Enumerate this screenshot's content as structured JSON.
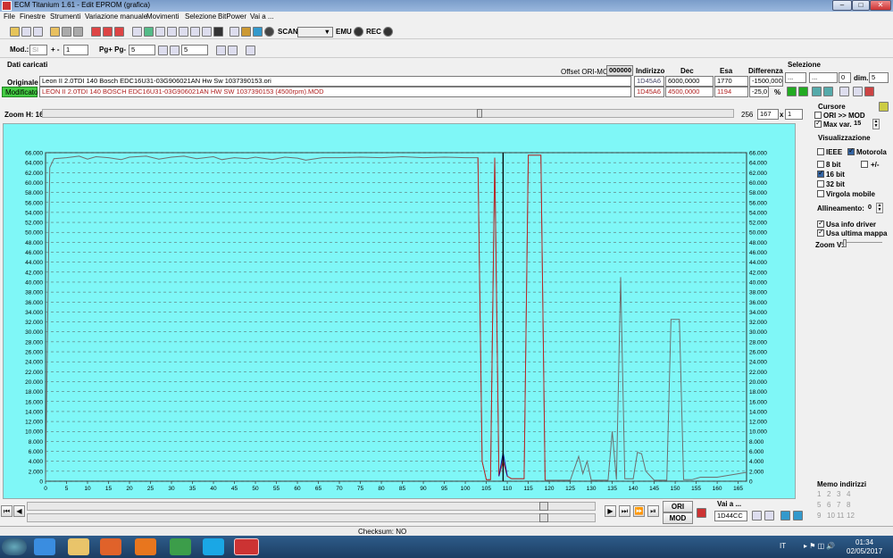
{
  "window": {
    "title": "ECM Titanium 1.61 - Edit EPROM (grafica)"
  },
  "menu": [
    "File",
    "Finestre",
    "Strumenti",
    "Variazione manuale",
    "Movimenti",
    "Selezione",
    "BitPower",
    "Vai a ..."
  ],
  "toolbar1": {
    "scan_label": "SCAN",
    "emu_label": "EMU",
    "rec_label": "REC"
  },
  "toolbar2": {
    "mod_label": "Mod.:",
    "mod_value": "SI",
    "plusminus": "+ -",
    "step_value": "1",
    "pg_label": "Pg+ Pg-",
    "pg_value": "5",
    "zoom_value": "5"
  },
  "data": {
    "section_title": "Dati caricati",
    "offset_label": "Offset ORI-MOD",
    "offset_value": "000000",
    "col_indirizzo": "Indirizzo",
    "col_dec": "Dec",
    "col_esa": "Esa",
    "col_diff": "Differenza",
    "selezione_label": "Selezione",
    "ori_label": "Originale",
    "ori_file": "Leon II 2.0TDI  140  Bosch EDC16U31-03G906021AN Hw Sw 1037390153.ori",
    "ori_addr": "1D45A6",
    "ori_dec": "6000,0000",
    "ori_esa": "1770",
    "ori_diff": "-1500,000X",
    "mod_label": "Modificato",
    "mod_file": "LEON II 2.0TDI  140  BOSCH EDC16U31-03G906021AN HW SW 1037390153 (4500rpm).MOD",
    "mod_addr": "1D45A6",
    "mod_dec": "4500,0000",
    "mod_esa": "1194",
    "mod_diff": "-25,0",
    "mod_pct": "%",
    "sel_a": "...",
    "sel_b": "...",
    "sel_c": "0",
    "dim_label": "dim.",
    "dim_value": "5"
  },
  "zoom": {
    "label": "Zoom H: 16",
    "val1": "256",
    "val2": "167",
    "x_label": "x",
    "val3": "1"
  },
  "right": {
    "cursore": "Cursore",
    "ori_mod": "ORI >> MOD",
    "maxvar": "Max var.",
    "maxvar_value": "15",
    "visual": "Visualizzazione",
    "ieee": "IEEE",
    "motorola": "Motorola",
    "b8": "8 bit",
    "pm": "+/-",
    "b16": "16 bit",
    "b32": "32 bit",
    "virgola": "Virgola mobile",
    "allin": "Allineamento:",
    "allin_value": "0",
    "usa_info": "Usa info driver",
    "usa_ultima": "Usa ultima mappa",
    "zoomv": "Zoom V:",
    "memo": "Memo indirizzi",
    "memo_nums": [
      "1",
      "2",
      "3",
      "4",
      "5",
      "6",
      "7",
      "8",
      "9",
      "10",
      "11",
      "12"
    ]
  },
  "bottom": {
    "ori_btn": "ORI",
    "mod_btn": "MOD",
    "vai_label": "Vai a ...",
    "vai_value": "1D44CC",
    "checksum": "Checksum: NO"
  },
  "taskbar": {
    "lang": "IT",
    "time": "01:34",
    "date": "02/05/2017"
  },
  "chart_data": {
    "type": "line",
    "y_ticks": [
      "0",
      "2.000",
      "4.000",
      "6.000",
      "8.000",
      "10.000",
      "12.000",
      "14.000",
      "16.000",
      "18.000",
      "20.000",
      "22.000",
      "24.000",
      "26.000",
      "28.000",
      "30.000",
      "32.000",
      "34.000",
      "36.000",
      "38.000",
      "40.000",
      "42.000",
      "44.000",
      "46.000",
      "48.000",
      "50.000",
      "52.000",
      "54.000",
      "56.000",
      "58.000",
      "60.000",
      "62.000",
      "64.000",
      "66.000"
    ],
    "x_ticks": [
      "0",
      "5",
      "10",
      "15",
      "20",
      "25",
      "30",
      "35",
      "40",
      "45",
      "50",
      "55",
      "60",
      "65",
      "70",
      "75",
      "80",
      "85",
      "90",
      "95",
      "100",
      "105",
      "110",
      "115",
      "120",
      "125",
      "130",
      "135",
      "140",
      "145",
      "150",
      "155",
      "160",
      "165"
    ],
    "ylim": [
      0,
      66000
    ],
    "xlim": [
      0,
      167
    ],
    "grid": true,
    "series": [
      {
        "color": "#6e6e6e",
        "points": [
          [
            0,
            0
          ],
          [
            1,
            63000
          ],
          [
            2,
            64800
          ],
          [
            5,
            65000
          ],
          [
            8,
            65300
          ],
          [
            10,
            64700
          ],
          [
            12,
            65200
          ],
          [
            15,
            65000
          ],
          [
            18,
            64600
          ],
          [
            20,
            65100
          ],
          [
            24,
            65300
          ],
          [
            27,
            64700
          ],
          [
            30,
            65100
          ],
          [
            33,
            65300
          ],
          [
            36,
            64800
          ],
          [
            40,
            65200
          ],
          [
            42,
            64600
          ],
          [
            45,
            65000
          ],
          [
            48,
            64800
          ],
          [
            50,
            65100
          ],
          [
            54,
            64600
          ],
          [
            57,
            65100
          ],
          [
            60,
            64900
          ],
          [
            62,
            64500
          ],
          [
            66,
            65000
          ],
          [
            70,
            65000
          ],
          [
            75,
            65100
          ],
          [
            80,
            65000
          ],
          [
            85,
            65200
          ],
          [
            90,
            65000
          ],
          [
            95,
            65100
          ],
          [
            100,
            65000
          ],
          [
            103,
            65000
          ],
          [
            104,
            4000
          ],
          [
            105,
            300
          ],
          [
            106,
            300
          ],
          [
            107,
            65000
          ],
          [
            108,
            1000
          ],
          [
            109,
            5000
          ],
          [
            110,
            1000
          ],
          [
            111,
            500
          ],
          [
            114,
            500
          ],
          [
            115,
            65500
          ],
          [
            118,
            65500
          ],
          [
            119,
            200
          ],
          [
            125,
            200
          ],
          [
            127,
            5000
          ],
          [
            128,
            1500
          ],
          [
            129,
            4000
          ],
          [
            130,
            200
          ],
          [
            134,
            200
          ],
          [
            135,
            10000
          ],
          [
            136,
            300
          ],
          [
            137,
            41000
          ],
          [
            138,
            500
          ],
          [
            140,
            500
          ],
          [
            141,
            5800
          ],
          [
            142,
            5500
          ],
          [
            143,
            2000
          ],
          [
            145,
            200
          ],
          [
            148,
            200
          ],
          [
            149,
            32500
          ],
          [
            151,
            32500
          ],
          [
            152,
            300
          ],
          [
            154,
            300
          ],
          [
            156,
            800
          ],
          [
            160,
            800
          ],
          [
            165,
            1500
          ],
          [
            167,
            1800
          ]
        ]
      },
      {
        "color": "#c02020",
        "points": [
          [
            103,
            65000
          ],
          [
            104,
            4000
          ],
          [
            105,
            300
          ],
          [
            106,
            300
          ],
          [
            107,
            65000
          ],
          [
            108,
            1000
          ],
          [
            109,
            4000
          ],
          [
            110,
            1000
          ],
          [
            111,
            500
          ],
          [
            114,
            500
          ],
          [
            115,
            65500
          ],
          [
            118,
            65500
          ],
          [
            119,
            200
          ]
        ]
      },
      {
        "color": "#1010a0",
        "points": [
          [
            108,
            1000
          ],
          [
            109,
            5800
          ],
          [
            110,
            1000
          ]
        ]
      }
    ]
  }
}
